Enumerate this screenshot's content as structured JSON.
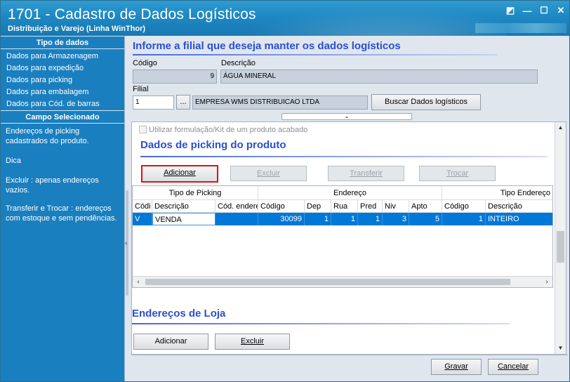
{
  "window": {
    "title": "1701 - Cadastro de Dados Logísticos",
    "subtitle": "Distribuição e Varejo (Linha WinThor)",
    "controls": [
      "◩",
      "—",
      "☐",
      "✕"
    ]
  },
  "sidebar": {
    "header1": "Tipo de dados",
    "items": [
      {
        "label": "Dados para Armazenagem"
      },
      {
        "label": "Dados para expedição"
      },
      {
        "label": "Dados para picking"
      },
      {
        "label": "Dados para embalagem"
      },
      {
        "label": "Dados para Cód. de barras"
      }
    ],
    "header2": "Campo Selecionado",
    "info_text": "Endereços de picking cadastrados do produto.",
    "dica_label": "Dica",
    "dica_text1": "Excluir : apenas endereços vazios.",
    "dica_text2": "Transferir e Trocar : endereços com estoque e sem pendências."
  },
  "form": {
    "header": "Informe a filial que deseja manter os dados logísticos",
    "codigo_label": "Código",
    "codigo_value": "9",
    "descricao_label": "Descrição",
    "descricao_value": "ÁGUA MINERAL",
    "filial_label": "Filial",
    "filial_value": "1",
    "filial_lookup": "...",
    "filial_name": "EMPRESA WMS DISTRIBUICAO LTDA",
    "buscar_label": "Buscar Dados logísticos",
    "collapse_icon": "⌄"
  },
  "picking": {
    "checkbox_label": "Utilizar formulação/Kit de um produto acabado",
    "title": "Dados de picking do produto",
    "buttons": {
      "adicionar": "Adicionar",
      "excluir": "Excluir",
      "transferir": "Transferir",
      "trocar": "Trocar"
    },
    "grid": {
      "groups": [
        "Tipo de Picking",
        "Endereço",
        "Tipo Endereço"
      ],
      "columns": [
        "Códi",
        "Descrição",
        "Cód. endere",
        "Código",
        "Dep",
        "Rua",
        "Pred",
        "Niv",
        "Apto",
        "Código",
        "Descrição"
      ],
      "rows": [
        [
          "V",
          "VENDA",
          "",
          "30099",
          "1",
          "1",
          "1",
          "3",
          "5",
          "1",
          "INTEIRO"
        ]
      ]
    }
  },
  "loja": {
    "title": "Endereços de Loja",
    "adicionar": "Adicionar",
    "excluir": "Excluir"
  },
  "footer": {
    "gravar": "Gravar",
    "cancelar": "Cancelar"
  }
}
